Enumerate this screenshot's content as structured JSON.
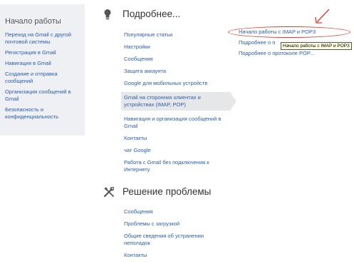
{
  "sidebar": {
    "title": "Начало работы",
    "items": [
      {
        "label": "Переход на Gmail с другой почтовой системы"
      },
      {
        "label": "Регистрация в Gmail"
      },
      {
        "label": "Навигация в Gmail"
      },
      {
        "label": "Создание и отправка сообщений"
      },
      {
        "label": "Организация сообщений в Gmail"
      },
      {
        "label": "Безопасность и конфиденциальность"
      }
    ]
  },
  "section1": {
    "title": "Подробнее...",
    "icon": "lightbulb-icon",
    "items": [
      {
        "label": "Популярные статьи"
      },
      {
        "label": "Настройки"
      },
      {
        "label": "Сообщения"
      },
      {
        "label": "Защита аккаунта"
      },
      {
        "label": "Google для мобильных устройств"
      },
      {
        "label": "Gmail на сторонних клиентах и устройствах (IMAP, POP)",
        "selected": true
      },
      {
        "label": "Навигация и организация сообщений в Gmail"
      },
      {
        "label": "Контакты"
      },
      {
        "label": "чат Google"
      },
      {
        "label": "Работа с Gmail без подключения к Интернету"
      }
    ]
  },
  "right_links": [
    {
      "label": "Начало работы с IMAP и POP3"
    },
    {
      "label": "Подробнее о п"
    },
    {
      "label": "Подробнее о протоколе POP..."
    }
  ],
  "tooltip": {
    "text": "Начало работы с IMAP и POP3"
  },
  "section2": {
    "title": "Решение проблемы",
    "icon": "tools-icon",
    "items": [
      {
        "label": "Сообщения"
      },
      {
        "label": "Проблемы с загрузкой"
      },
      {
        "label": "Общие сведения об устранении неполадок"
      },
      {
        "label": "Контакты"
      }
    ]
  },
  "colors": {
    "link": "#2a5db0",
    "highlight_annotation": "#e23b2c",
    "sidebar_bg": "#eef0f3",
    "selected_bg": "#e6e7e9"
  }
}
